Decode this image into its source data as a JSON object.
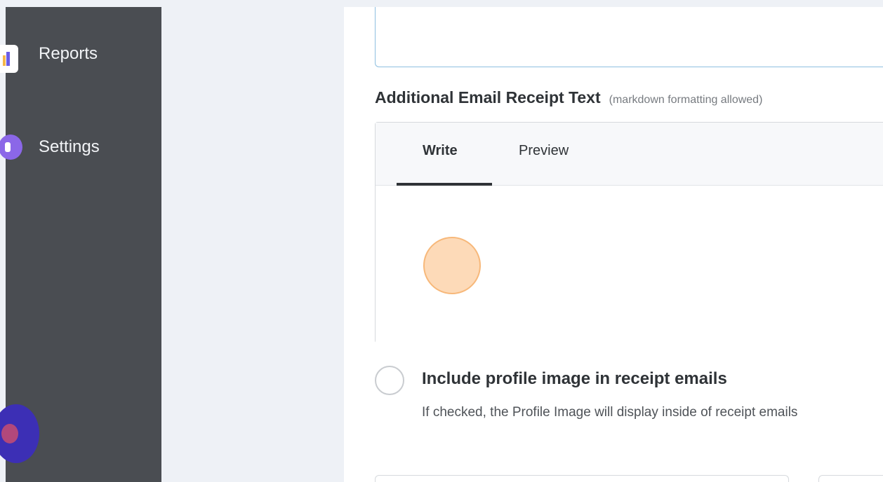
{
  "sidebar": {
    "items": [
      {
        "label": "Reports",
        "icon": "reports-icon"
      },
      {
        "label": "Settings",
        "icon": "gear-icon"
      }
    ]
  },
  "receipt": {
    "title": "Additional Email Receipt Text",
    "hint": "(markdown formatting allowed)",
    "tabs": [
      {
        "label": "Write",
        "active": true
      },
      {
        "label": "Preview",
        "active": false
      }
    ]
  },
  "profile_option": {
    "label": "Include profile image in receipt emails",
    "help": "If checked, the Profile Image will display inside of receipt emails",
    "checked": false
  },
  "colors": {
    "sidebar_bg": "#4a4d52",
    "page_bg": "#eef1f6",
    "accent_purple": "#8b67e8",
    "focus_border": "#8ebfe0"
  }
}
